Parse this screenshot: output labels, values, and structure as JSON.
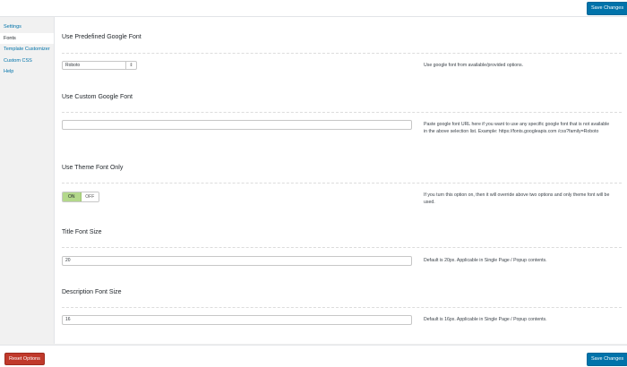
{
  "header": {
    "save_label": "Save Changes"
  },
  "sidebar": {
    "items": [
      {
        "label": "Settings",
        "active": false
      },
      {
        "label": "Fonts",
        "active": true
      },
      {
        "label": "Template Customizer",
        "active": false
      },
      {
        "label": "Custom CSS",
        "active": false
      },
      {
        "label": "Help",
        "active": false
      }
    ]
  },
  "sections": {
    "predefined_font": {
      "title": "Use Predefined Google Font",
      "selected": "Roboto",
      "arrow": "⇕",
      "description": "Use google font from available/provided options."
    },
    "custom_font": {
      "title": "Use Custom Google Font",
      "value": "",
      "description": "Paste google font URL here if you want to use any specific google font that is not available in the above selection list. Example: https://fonts.googleapis.com /css?family=Roboto"
    },
    "theme_font": {
      "title": "Use Theme Font Only",
      "on_label": "ON",
      "off_label": "OFF",
      "state": "ON",
      "description": "If you turn this option on, then it will override above two options and only theme font will be used."
    },
    "title_font_size": {
      "title": "Title Font Size",
      "value": "20",
      "description": "Default is 20px. Applicable in Single Page / Popup contents."
    },
    "description_font_size": {
      "title": "Description Font Size",
      "value": "16",
      "description": "Default is 16px. Applicable in Single Page / Popup contents."
    }
  },
  "footer": {
    "reset_label": "Reset Options",
    "save_label": "Save Changes"
  },
  "colors": {
    "primary": "#0073aa",
    "danger": "#c0392b",
    "toggle_on": "#b3d88b"
  }
}
